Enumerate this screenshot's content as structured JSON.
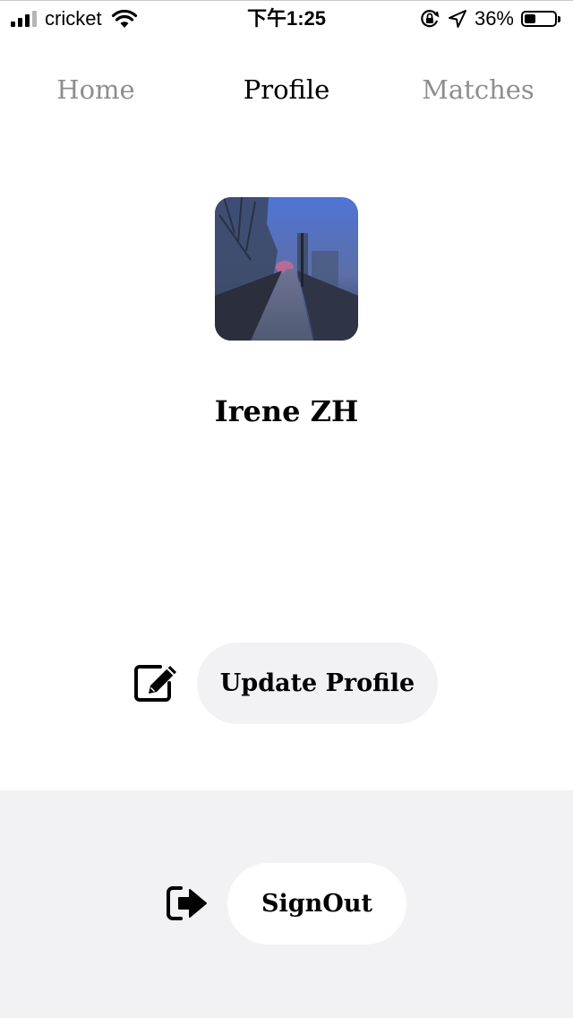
{
  "status_bar": {
    "carrier": "cricket",
    "time": "下午1:25",
    "battery_percent": "36%",
    "battery_level": 0.36,
    "icons": [
      "signal-icon",
      "wifi-icon",
      "orientation-lock-icon",
      "location-arrow-icon",
      "battery-icon"
    ]
  },
  "tabs": [
    {
      "label": "Home",
      "active": false
    },
    {
      "label": "Profile",
      "active": true
    },
    {
      "label": "Matches",
      "active": false
    }
  ],
  "profile": {
    "name": "Irene ZH"
  },
  "actions": {
    "update_label": "Update Profile",
    "update_icon": "edit-icon",
    "signout_label": "SignOut",
    "signout_icon": "sign-out-icon"
  },
  "colors": {
    "active_tab": "#000000",
    "inactive_tab": "#8e8e8e",
    "button_bg": "#f2f1f4",
    "panel_bg": "#f2f1f4"
  }
}
